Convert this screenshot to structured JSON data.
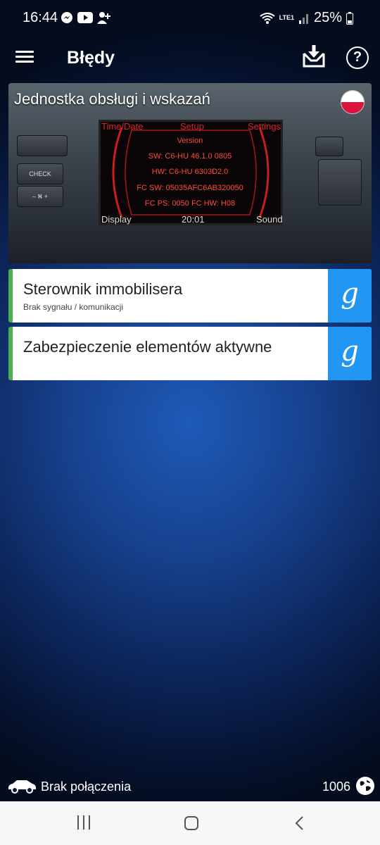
{
  "status_bar": {
    "time": "16:44",
    "battery": "25%",
    "network_label": "LTE1",
    "left_icons": [
      "messenger-icon",
      "youtube-icon",
      "add-person-icon"
    ],
    "right_icons": [
      "wifi-icon",
      "volte-icon",
      "signal-icon",
      "battery-icon"
    ]
  },
  "app_bar": {
    "title": "Błędy",
    "icons": [
      "menu-icon",
      "download-inbox-icon",
      "help-icon"
    ]
  },
  "module": {
    "title": "Jednostka obsługi i wskazań",
    "flag": "poland-flag-icon",
    "screen": {
      "top_left": "Time/Date",
      "top_center": "Setup",
      "top_right": "Settings",
      "heading": "Version",
      "lines": [
        "SW: C6-HU 46.1.0 0805",
        "HW: C6-HU 6303D2.0",
        "FC SW: 05035AFC6AB320050",
        "FC PS: 0050 FC HW: H08"
      ],
      "bottom_left": "Display",
      "bottom_center": "20:01",
      "bottom_right": "Sound"
    },
    "dash_buttons": {
      "check": "CHECK",
      "minus_plus": "– ⛕ +"
    }
  },
  "faults": [
    {
      "name": "Sterownik immobilisera",
      "status": "Brak sygnału / komunikacji",
      "search_label": "g"
    },
    {
      "name": "Zabezpieczenie elementów aktywne",
      "status": "",
      "search_label": "g"
    }
  ],
  "footer": {
    "connection": "Brak połączenia",
    "counter": "1006"
  },
  "colors": {
    "accent_blue": "#2196f3",
    "fault_bar": "#4caf50",
    "screen_red": "#d8232a"
  }
}
